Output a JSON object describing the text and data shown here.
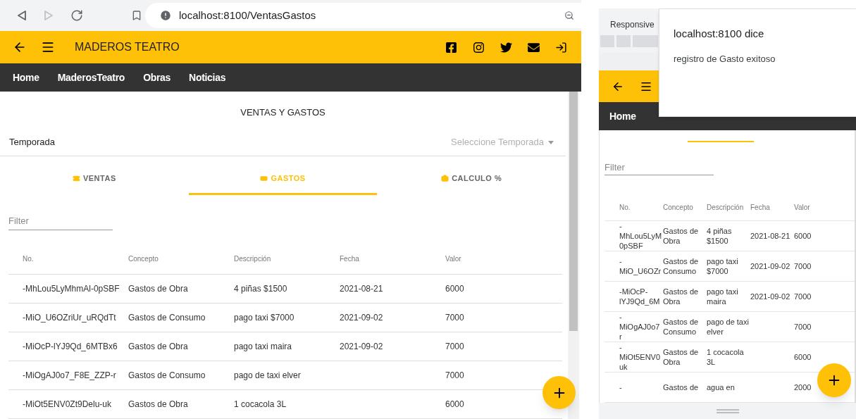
{
  "browser": {
    "url": "localhost:8100/VentasGastos"
  },
  "app": {
    "title": "MADEROS TEATRO",
    "nav": [
      {
        "label": "Home"
      },
      {
        "label": "MaderosTeatro"
      },
      {
        "label": "Obras"
      },
      {
        "label": "Noticias"
      }
    ],
    "page_title": "VENTAS Y GASTOS",
    "season": {
      "label": "Temporada",
      "placeholder": "Seleccione Temporada"
    },
    "tabs": [
      {
        "label": "VENTAS",
        "selected": false
      },
      {
        "label": "GASTOS",
        "selected": true
      },
      {
        "label": "CALCULO %",
        "selected": false
      }
    ],
    "filter": {
      "placeholder": "Filter"
    },
    "table": {
      "columns": [
        "No.",
        "Concepto",
        "Descripción",
        "Fecha",
        "Valor"
      ],
      "rows": [
        [
          "-MhLou5LyMhmAl-0pSBF",
          "Gastos de Obra",
          "4 piñas $1500",
          "2021-08-21",
          "6000"
        ],
        [
          "-MiO_U6OZriUr_uRQdTt",
          "Gastos de Consumo",
          "pago taxi $7000",
          "2021-09-02",
          "7000"
        ],
        [
          "-MiOcP-lYJ9Qd_6MTBx6",
          "Gastos de Obra",
          "pago taxi maira",
          "2021-09-02",
          "7000"
        ],
        [
          "-MiOgAJ0o7_F8E_ZZP-r",
          "Gastos de Consumo",
          "pago de taxi elver",
          "",
          "7000"
        ],
        [
          "-MiOt5ENV0Zt9Delu-uk",
          "Gastos de Obra",
          "1 cocacola 3L",
          "",
          "6000"
        ]
      ]
    }
  },
  "mobile_preview": {
    "toolbar_label": "Responsive",
    "nav": [
      {
        "label": "Home"
      }
    ],
    "filter": {
      "placeholder": "Filter"
    },
    "table": {
      "columns": [
        "No.",
        "Concepto",
        "Descripción",
        "Fecha",
        "Valor"
      ],
      "rows": [
        [
          "- MhLou5LyM 0pSBF",
          "Gastos de Obra",
          "4 piñas $1500",
          "2021-08-21",
          "6000"
        ],
        [
          "- MiO_U6OZr",
          "Gastos de Consumo",
          "pago taxi $7000",
          "2021-09-02",
          "7000"
        ],
        [
          "-MiOcP- lYJ9Qd_6M",
          "Gastos de Obra",
          "pago taxi maira",
          "2021-09-02",
          "7000"
        ],
        [
          "- MiOgAJ0o7 r",
          "Gastos de Consumo",
          "pago de taxi elver",
          "",
          "7000"
        ],
        [
          "- MiOt5ENV0 uk",
          "Gastos de Obra",
          "1 cocacola 3L",
          "",
          "6000"
        ],
        [
          "-",
          "Gastos de",
          "agua en",
          "",
          "2000"
        ]
      ]
    },
    "dialog": {
      "title": "localhost:8100 dice",
      "message": "registro de Gasto exitoso"
    }
  }
}
